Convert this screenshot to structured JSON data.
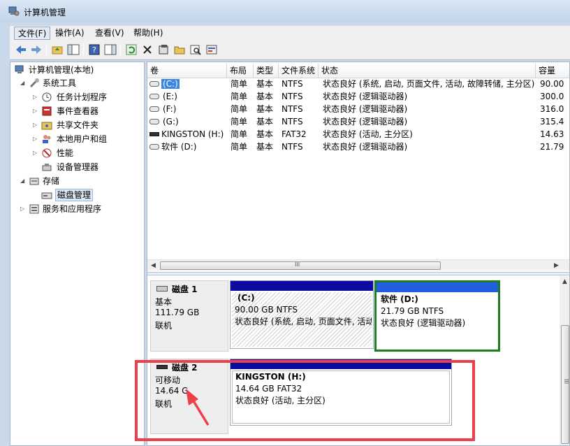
{
  "window": {
    "title": "计算机管理"
  },
  "menu": [
    {
      "label": "文件(F)",
      "active": true
    },
    {
      "label": "操作(A)"
    },
    {
      "label": "查看(V)"
    },
    {
      "label": "帮助(H)"
    }
  ],
  "toolbar": {
    "icons": [
      "back-icon",
      "forward-icon",
      "up-folder-icon",
      "show-tree-icon",
      "help-icon",
      "properties-pane-icon",
      "refresh-icon",
      "delete-icon",
      "properties-icon",
      "open-icon",
      "find-icon",
      "disk-tool-icon"
    ]
  },
  "tree": {
    "root": "计算机管理(本地)",
    "system_tools": "系统工具",
    "task_scheduler": "任务计划程序",
    "event_viewer": "事件查看器",
    "shared_folders": "共享文件夹",
    "local_users": "本地用户和组",
    "performance": "性能",
    "device_manager": "设备管理器",
    "storage": "存储",
    "disk_management": "磁盘管理",
    "services": "服务和应用程序"
  },
  "table": {
    "columns": [
      "卷",
      "布局",
      "类型",
      "文件系统",
      "状态",
      "容量"
    ],
    "rows": [
      {
        "vol": "(C:)",
        "layout": "简单",
        "type": "基本",
        "fs": "NTFS",
        "status": "状态良好 (系统, 启动, 页面文件, 活动, 故障转储, 主分区)",
        "cap": "90.00"
      },
      {
        "vol": "(E:)",
        "layout": "简单",
        "type": "基本",
        "fs": "NTFS",
        "status": "状态良好 (逻辑驱动器)",
        "cap": "300.0"
      },
      {
        "vol": "(F:)",
        "layout": "简单",
        "type": "基本",
        "fs": "NTFS",
        "status": "状态良好 (逻辑驱动器)",
        "cap": "316.0"
      },
      {
        "vol": "(G:)",
        "layout": "简单",
        "type": "基本",
        "fs": "NTFS",
        "status": "状态良好 (逻辑驱动器)",
        "cap": "315.4"
      },
      {
        "vol": "KINGSTON (H:)",
        "layout": "简单",
        "type": "基本",
        "fs": "FAT32",
        "status": "状态良好 (活动, 主分区)",
        "cap": "14.63"
      },
      {
        "vol": "软件 (D:)",
        "layout": "简单",
        "type": "基本",
        "fs": "NTFS",
        "status": "状态良好 (逻辑驱动器)",
        "cap": "21.79"
      }
    ]
  },
  "disks": [
    {
      "name": "磁盘 1",
      "kind": "基本",
      "size": "111.79 GB",
      "state": "联机",
      "partitions": [
        {
          "name": "(C:)",
          "size": "90.00 GB NTFS",
          "status": "状态良好 (系统, 启动, 页面文件, 活动"
        },
        {
          "name": "软件  (D:)",
          "size": "21.79 GB NTFS",
          "status": "状态良好 (逻辑驱动器)"
        }
      ]
    },
    {
      "name": "磁盘 2",
      "kind": "可移动",
      "size": "14.64 G",
      "state": "联机",
      "partitions": [
        {
          "name": "KINGSTON  (H:)",
          "size": "14.64 GB FAT32",
          "status": "状态良好 (活动, 主分区)"
        }
      ]
    }
  ],
  "scroll": {
    "h_mark": "III",
    "v_mark": "III"
  },
  "colors": {
    "partition_bar": "#0b0ba0",
    "highlight": "#ec3f48",
    "selected_volume": "#3a86e0"
  }
}
